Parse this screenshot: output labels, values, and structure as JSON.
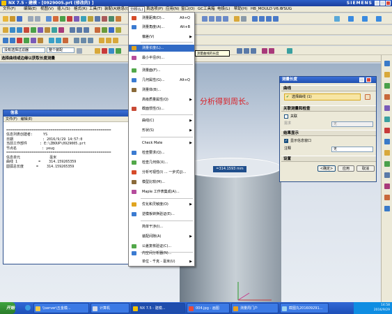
{
  "window": {
    "title": "NX 7.5 - 建模 - [0929005.prt (修改的) ]",
    "brand": "SIEMENS"
  },
  "menubar": [
    "文件(F)",
    "编辑(E)",
    "视图(V)",
    "插入(S)",
    "格式(R)",
    "工具(T)",
    "装配(A)",
    "信息(I)",
    "分析(L)",
    "首选项(P)",
    "应用(N)",
    "窗口(O)",
    "GC工具箱",
    "电极(L)",
    "帮助(H)",
    "HB_MOULD V6.6",
    "YSUG"
  ],
  "toolbar": {
    "filter_select": "没有选择过滤器",
    "scope_select": "整个装配"
  },
  "statusline": "选择曲线或边缘以获取长度测量",
  "annotation": "分析得到周长。",
  "cylinder_label": "=314.1593 mm",
  "dropdown": {
    "items": [
      {
        "label": "测量距离(D)...",
        "shortcut": "Alt+Q",
        "icon_color": "#d64b2a"
      },
      {
        "label": "测量角度(A)...",
        "shortcut": "Alt+B",
        "icon_color": "#3b7bd1"
      },
      {
        "label": "偏差(V)",
        "shortcut": "",
        "arrow": "▶",
        "icon_color": ""
      },
      {
        "label": "测量长度(L)...",
        "shortcut": "",
        "icon_color": "#e0a420"
      },
      {
        "label": "最小半径(R)...",
        "shortcut": "",
        "icon_color": "#b54c9c"
      },
      {
        "label": "测量面(F)...",
        "shortcut": "",
        "icon_color": "#52a84a"
      },
      {
        "label": "几何属性(G)...",
        "shortcut": "Alt+Q",
        "icon_color": "#3b7bd1"
      },
      {
        "label": "测量体(B)...",
        "shortcut": "",
        "icon_color": "#8a6a3a"
      },
      {
        "label": "高级质量属性(Q)",
        "shortcut": "",
        "arrow": "▶",
        "icon_color": ""
      },
      {
        "label": "截面惯性(S)...",
        "shortcut": "",
        "icon_color": "#c94a36"
      },
      {
        "label": "曲线(C)",
        "shortcut": "",
        "arrow": "▶",
        "icon_color": ""
      },
      {
        "label": "形状(S)",
        "shortcut": "",
        "arrow": "▶",
        "icon_color": ""
      },
      {
        "label": "Check Mate",
        "shortcut": "",
        "arrow": "▶",
        "icon_color": ""
      },
      {
        "label": "检查要求(Q)...",
        "shortcut": "",
        "icon_color": "#3b7bd1"
      },
      {
        "label": "检查几何体(X)...",
        "shortcut": "",
        "icon_color": "#52a84a"
      },
      {
        "label": "分析可视性(I) ... 一步式(J)...",
        "shortcut": "",
        "icon_color": "#d64b2a"
      },
      {
        "label": "模型比较(M)...",
        "shortcut": "",
        "icon_color": "#8a6a3a"
      },
      {
        "label": "Maple 工作表集成(A)...",
        "shortcut": "",
        "icon_color": "#b54c9c"
      },
      {
        "label": "优化和灵敏度(O)",
        "shortcut": "",
        "arrow": "▶",
        "icon_color": "#e0a420"
      },
      {
        "label": "逆模板转换验证(E)...",
        "shortcut": "",
        "icon_color": "#3b7bd1"
      },
      {
        "label": "简单干涉(I)...",
        "shortcut": "",
        "icon_color": ""
      },
      {
        "label": "装配间隙(A)",
        "shortcut": "",
        "arrow": "▶",
        "icon_color": ""
      },
      {
        "label": "公差复核验证(C)...",
        "shortcut": "",
        "icon_color": "#52a84a"
      },
      {
        "label": "内空间分析器(N)...",
        "shortcut": "",
        "icon_color": "#3b7bd1"
      },
      {
        "label": "单位 - 千克 - 毫米(U)",
        "shortcut": "",
        "arrow": "▶",
        "icon_color": ""
      }
    ],
    "tooltip": "测量曲线的长度"
  },
  "info": {
    "title": "信息",
    "menu": [
      "文件(F)",
      "编辑(E)"
    ],
    "lines": [
      "==================================================",
      "信息列表创建者:     YS",
      "日期              : 2016/9/29 14:57:0",
      "当前工作部件      : E:\\ZBOUP\\0929005.prt",
      "节点名            : yeug",
      "==================================================",
      "",
      "信息单元              毫米",
      "",
      "曲线 1          =    314.159265359",
      "",
      "圆弧总长度      =    314.159265359"
    ]
  },
  "measure": {
    "title": "测量长度",
    "sec_curve": "曲线",
    "select_curve": "选择曲线 (1)",
    "sec_assoc": "关联测量和检查",
    "assoc_label": "关联",
    "req_label": "需求",
    "req_value": "无",
    "sec_result": "结果显示",
    "show_info_label": "显示信息窗口",
    "note_label": "注释",
    "note_value": "无",
    "sec_settings": "设置",
    "ok": "<确定>",
    "apply": "应用",
    "cancel": "取消"
  },
  "taskbar": {
    "start": "开始",
    "tasks": [
      "\\\\server\\五金模...",
      "计算机",
      "NX 7.5 - 建模...",
      "004.jpg - 画图",
      "测量周门户",
      "截图丸201609291..."
    ],
    "clock_time": "14:58",
    "clock_date": "2016/9/29"
  }
}
